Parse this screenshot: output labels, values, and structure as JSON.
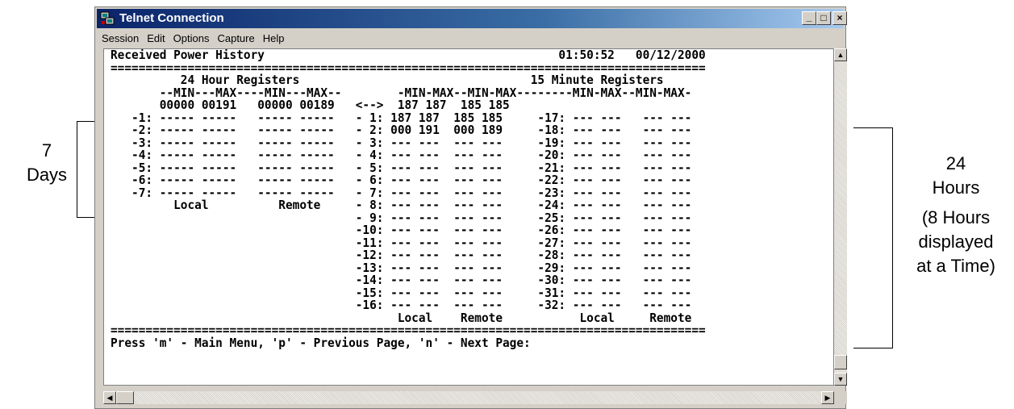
{
  "annotations": {
    "left_top": "7",
    "left_bottom": "Days",
    "right_line1": "24",
    "right_line2": "Hours",
    "right_line3": "(8 Hours",
    "right_line4": "displayed",
    "right_line5": "at a Time)"
  },
  "window": {
    "title": "Telnet Connection",
    "minimize_glyph": "_",
    "maximize_glyph": "□",
    "close_glyph": "×"
  },
  "menu": [
    "Session",
    "Edit",
    "Options",
    "Capture",
    "Help"
  ],
  "terminal": {
    "lines": [
      "Received Power History                                          01:50:52   00/12/2000",
      "=====================================================================================",
      "          24 Hour Registers                                 15 Minute Registers",
      "       --MIN---MAX----MIN---MAX--        -MIN-MAX--MIN-MAX--------MIN-MAX--MIN-MAX-",
      "       00000 00191   00000 00189   <-->  187 187  185 185",
      "   -1: ----- -----   ----- -----   - 1: 187 187  185 185     -17: --- ---   --- ---",
      "   -2: ----- -----   ----- -----   - 2: 000 191  000 189     -18: --- ---   --- ---",
      "   -3: ----- -----   ----- -----   - 3: --- ---  --- ---     -19: --- ---   --- ---",
      "   -4: ----- -----   ----- -----   - 4: --- ---  --- ---     -20: --- ---   --- ---",
      "   -5: ----- -----   ----- -----   - 5: --- ---  --- ---     -21: --- ---   --- ---",
      "   -6: ----- -----   ----- -----   - 6: --- ---  --- ---     -22: --- ---   --- ---",
      "   -7: ----- -----   ----- -----   - 7: --- ---  --- ---     -23: --- ---   --- ---",
      "         Local          Remote     - 8: --- ---  --- ---     -24: --- ---   --- ---",
      "                                   - 9: --- ---  --- ---     -25: --- ---   --- ---",
      "                                   -10: --- ---  --- ---     -26: --- ---   --- ---",
      "                                   -11: --- ---  --- ---     -27: --- ---   --- ---",
      "                                   -12: --- ---  --- ---     -28: --- ---   --- ---",
      "                                   -13: --- ---  --- ---     -29: --- ---   --- ---",
      "                                   -14: --- ---  --- ---     -30: --- ---   --- ---",
      "                                   -15: --- ---  --- ---     -31: --- ---   --- ---",
      "                                   -16: --- ---  --- ---     -32: --- ---   --- ---",
      "                                         Local    Remote           Local     Remote",
      "=====================================================================================",
      "Press 'm' - Main Menu, 'p' - Previous Page, 'n' - Next Page:"
    ]
  },
  "scrollbars": {
    "up_glyph": "▲",
    "down_glyph": "▼",
    "left_glyph": "◀",
    "right_glyph": "▶"
  }
}
